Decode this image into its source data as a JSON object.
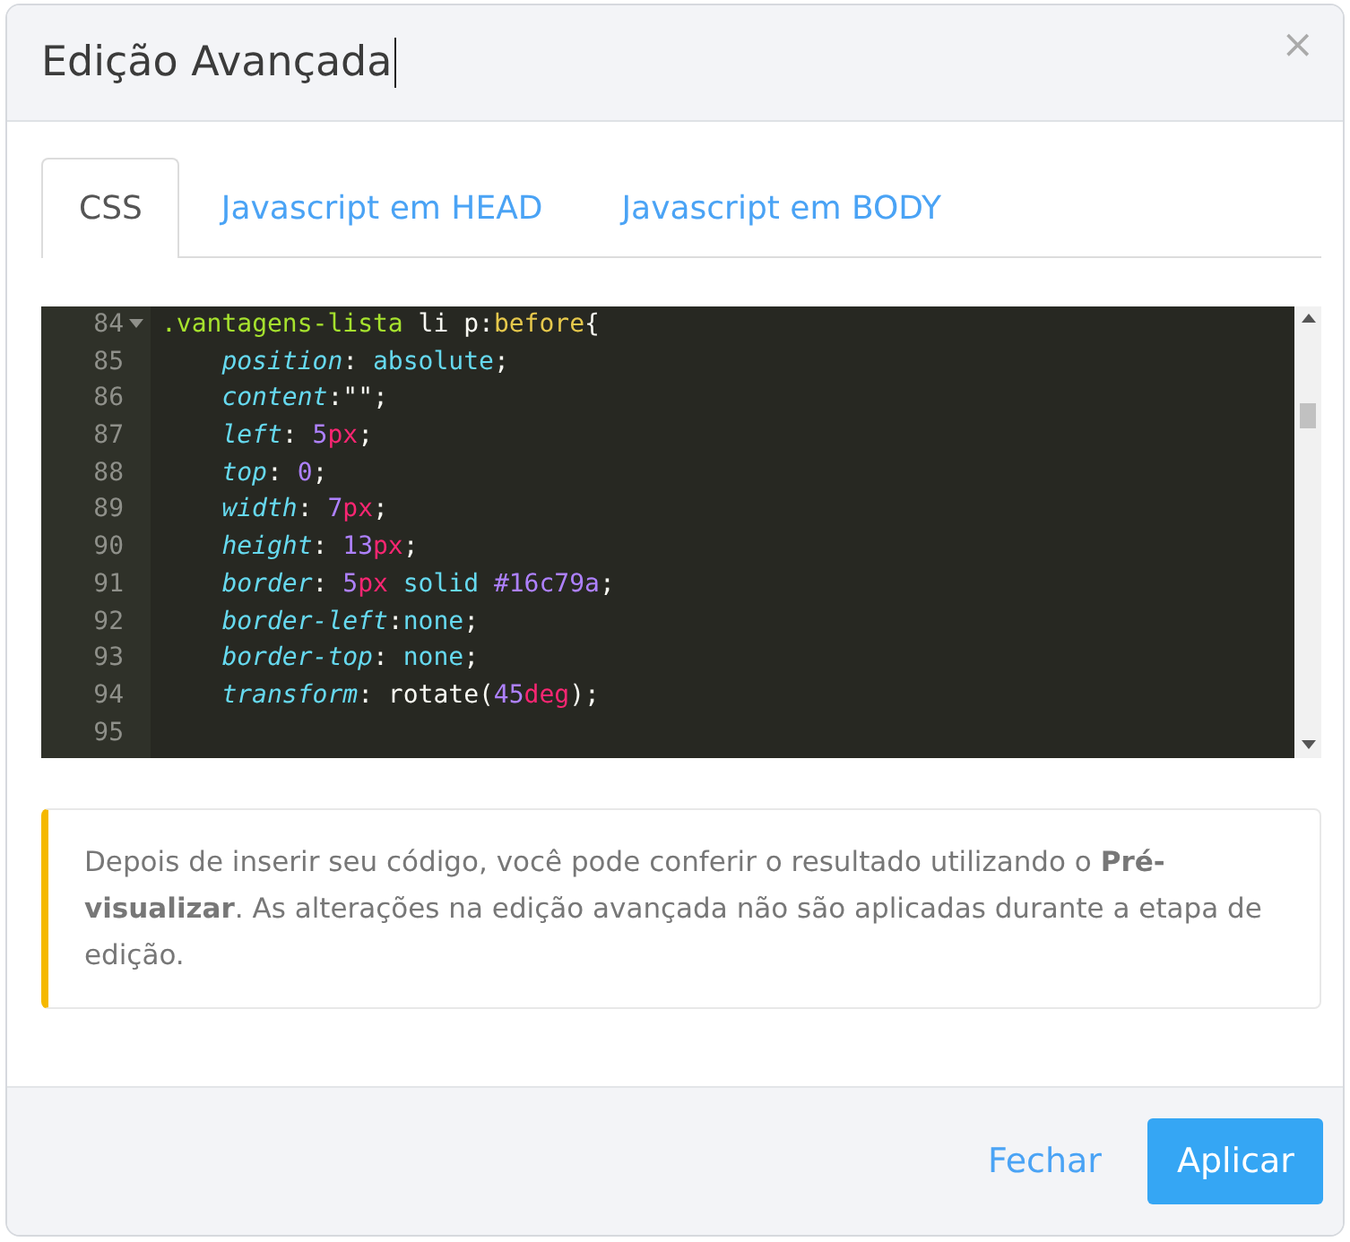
{
  "dialog": {
    "title": "Edição Avançada",
    "close": "×"
  },
  "tabs": [
    {
      "label": "CSS",
      "selected": true
    },
    {
      "label": "Javascript em HEAD",
      "selected": false
    },
    {
      "label": "Javascript em BODY",
      "selected": false
    }
  ],
  "editor": {
    "lines": [
      {
        "number": "84",
        "fold": true,
        "indent": false,
        "tokens": [
          {
            "kind": "selector",
            "text": ".vantagens-lista"
          },
          {
            "kind": "plain",
            "text": " li p:"
          },
          {
            "kind": "pseudo",
            "text": "before"
          },
          {
            "kind": "plain",
            "text": "{"
          }
        ]
      },
      {
        "number": "85",
        "fold": false,
        "indent": true,
        "tokens": [
          {
            "kind": "property",
            "text": "position"
          },
          {
            "kind": "plain",
            "text": ": "
          },
          {
            "kind": "keyword",
            "text": "absolute"
          },
          {
            "kind": "plain",
            "text": ";"
          }
        ]
      },
      {
        "number": "86",
        "fold": false,
        "indent": true,
        "tokens": [
          {
            "kind": "property",
            "text": "content"
          },
          {
            "kind": "plain",
            "text": ":"
          },
          {
            "kind": "string",
            "text": "\"\""
          },
          {
            "kind": "plain",
            "text": ";"
          }
        ]
      },
      {
        "number": "87",
        "fold": false,
        "indent": true,
        "tokens": [
          {
            "kind": "property",
            "text": "left"
          },
          {
            "kind": "plain",
            "text": ": "
          },
          {
            "kind": "number",
            "text": "5"
          },
          {
            "kind": "unit",
            "text": "px"
          },
          {
            "kind": "plain",
            "text": ";"
          }
        ]
      },
      {
        "number": "88",
        "fold": false,
        "indent": true,
        "tokens": [
          {
            "kind": "property",
            "text": "top"
          },
          {
            "kind": "plain",
            "text": ": "
          },
          {
            "kind": "number",
            "text": "0"
          },
          {
            "kind": "plain",
            "text": ";"
          }
        ]
      },
      {
        "number": "89",
        "fold": false,
        "indent": true,
        "tokens": [
          {
            "kind": "property",
            "text": "width"
          },
          {
            "kind": "plain",
            "text": ": "
          },
          {
            "kind": "number",
            "text": "7"
          },
          {
            "kind": "unit",
            "text": "px"
          },
          {
            "kind": "plain",
            "text": ";"
          }
        ]
      },
      {
        "number": "90",
        "fold": false,
        "indent": true,
        "tokens": [
          {
            "kind": "property",
            "text": "height"
          },
          {
            "kind": "plain",
            "text": ": "
          },
          {
            "kind": "number",
            "text": "13"
          },
          {
            "kind": "unit",
            "text": "px"
          },
          {
            "kind": "plain",
            "text": ";"
          }
        ]
      },
      {
        "number": "91",
        "fold": false,
        "indent": true,
        "tokens": [
          {
            "kind": "property",
            "text": "border"
          },
          {
            "kind": "plain",
            "text": ": "
          },
          {
            "kind": "number",
            "text": "5"
          },
          {
            "kind": "unit",
            "text": "px"
          },
          {
            "kind": "keyword",
            "text": " solid "
          },
          {
            "kind": "number",
            "text": "#16c79a"
          },
          {
            "kind": "plain",
            "text": ";"
          }
        ]
      },
      {
        "number": "92",
        "fold": false,
        "indent": true,
        "tokens": [
          {
            "kind": "property",
            "text": "border-left"
          },
          {
            "kind": "plain",
            "text": ":"
          },
          {
            "kind": "keyword",
            "text": "none"
          },
          {
            "kind": "plain",
            "text": ";"
          }
        ]
      },
      {
        "number": "93",
        "fold": false,
        "indent": true,
        "tokens": [
          {
            "kind": "property",
            "text": "border-top"
          },
          {
            "kind": "plain",
            "text": ": "
          },
          {
            "kind": "keyword",
            "text": "none"
          },
          {
            "kind": "plain",
            "text": ";"
          }
        ]
      },
      {
        "number": "94",
        "fold": false,
        "indent": true,
        "tokens": [
          {
            "kind": "property",
            "text": "transform"
          },
          {
            "kind": "plain",
            "text": ": rotate("
          },
          {
            "kind": "number",
            "text": "45"
          },
          {
            "kind": "unit",
            "text": "deg"
          },
          {
            "kind": "plain",
            "text": ");"
          }
        ]
      },
      {
        "number": "95",
        "fold": false
      }
    ]
  },
  "notice": "Depois de inserir seu código, você pode conferir o resultado utilizando o **Pré-visualizar**. As alterações na edição avançada não são aplicadas durante a etapa de edição.",
  "buttons": [
    {
      "label": "Fechar",
      "kind": "link"
    },
    {
      "label": "Aplicar",
      "kind": "primary"
    }
  ]
}
